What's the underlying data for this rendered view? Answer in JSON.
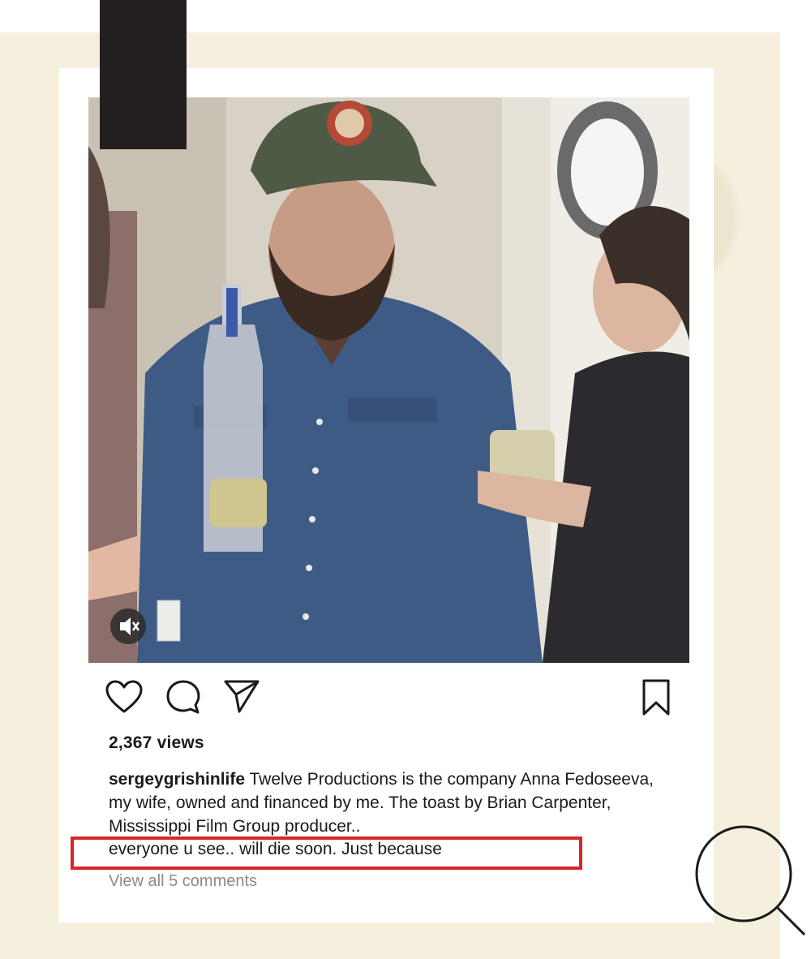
{
  "post": {
    "views": "2,367 views",
    "username": "sergeygrishinlife",
    "caption_text": " Twelve Productions is the company Anna Fedoseeva, my wife, owned and financed by me. The toast by Brian Carpenter, Mississippi Film Group producer..",
    "caption_highlight": "everyone u see.. will die soon. Just because",
    "view_all_comments": "View all 5 comments"
  },
  "icons": {
    "like": "heart-icon",
    "comment": "comment-icon",
    "share": "send-icon",
    "save": "bookmark-icon",
    "mute": "speaker-muted-icon",
    "search": "magnifier-icon"
  },
  "colors": {
    "background": "#f5f0de",
    "card": "#ffffff",
    "highlight_border": "#d9262c",
    "tab": "#231f20"
  }
}
